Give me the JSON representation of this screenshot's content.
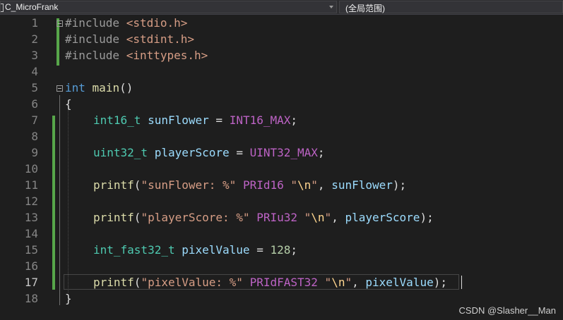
{
  "navbar": {
    "project": "C_MicroFrank",
    "scope": "(全局范围)"
  },
  "editor": {
    "line_numbers": [
      "1",
      "2",
      "3",
      "4",
      "5",
      "6",
      "7",
      "8",
      "9",
      "10",
      "11",
      "12",
      "13",
      "14",
      "15",
      "16",
      "17",
      "18"
    ],
    "current_line": "17",
    "lines": {
      "l1": [
        "#include",
        "<stdio.h>"
      ],
      "l2": [
        "#include",
        "<stdint.h>"
      ],
      "l3": [
        "#include",
        "<inttypes.h>"
      ],
      "l5": [
        "int",
        "main",
        "()"
      ],
      "l6": [
        "{"
      ],
      "l7": [
        "int16_t",
        "sunFlower",
        "=",
        "INT16_MAX",
        ";"
      ],
      "l9": [
        "uint32_t",
        "playerScore",
        "=",
        "UINT32_MAX",
        ";"
      ],
      "l11": [
        "printf",
        "(",
        "\"sunFlower: %\"",
        "PRId16",
        "\"",
        "\\n",
        "\"",
        ",",
        "sunFlower",
        ");"
      ],
      "l13": [
        "printf",
        "(",
        "\"playerScore: %\"",
        "PRIu32",
        "\"",
        "\\n",
        "\"",
        ",",
        "playerScore",
        ");"
      ],
      "l15": [
        "int_fast32_t",
        "pixelValue",
        "=",
        "128",
        ";"
      ],
      "l17": [
        "printf",
        "(",
        "\"pixelValue: %\"",
        "PRIdFAST32",
        "\"",
        "\\n",
        "\"",
        ",",
        "pixelValue",
        ");"
      ],
      "l18": [
        "}"
      ]
    }
  },
  "colors": {
    "background": "#1e1e1e",
    "change_marker": "#57a64a",
    "keyword": "#569cd6",
    "type": "#4ec9b0",
    "variable": "#9cdcfe",
    "macro": "#bd63c5",
    "function": "#dcdcaa",
    "string": "#d69d85"
  },
  "watermark": "CSDN @Slasher__Man"
}
